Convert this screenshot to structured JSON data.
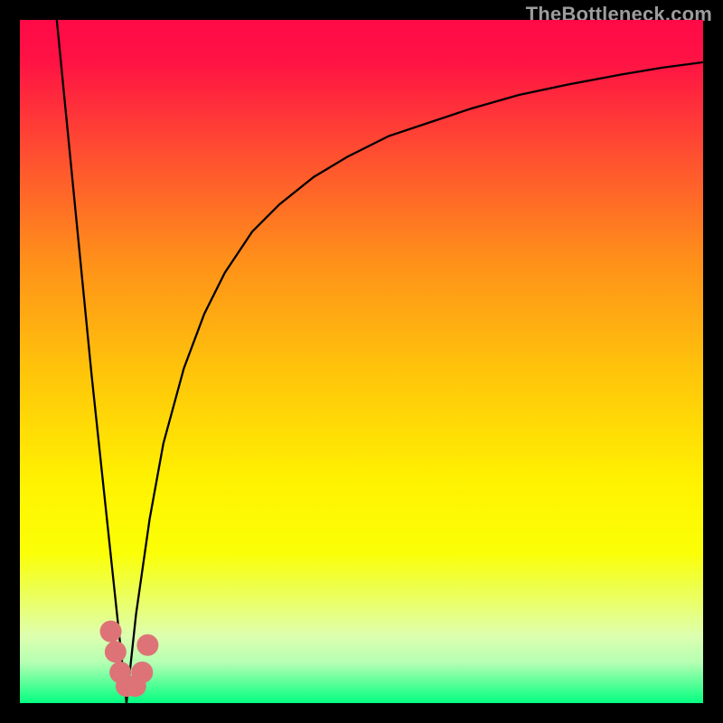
{
  "watermark": "TheBottleneck.com",
  "chart_data": {
    "type": "line",
    "title": "",
    "xlabel": "",
    "ylabel": "",
    "xlim": [
      0,
      100
    ],
    "ylim": [
      0,
      100
    ],
    "grid": false,
    "series": [
      {
        "name": "left-descending-line",
        "color": "#000000",
        "x": [
          5.4,
          10.5,
          15.6
        ],
        "values": [
          100,
          48,
          0
        ]
      },
      {
        "name": "right-rising-curve",
        "color": "#000000",
        "x": [
          15.6,
          17,
          19,
          21,
          24,
          27,
          30,
          34,
          38,
          43,
          48,
          54,
          60,
          66,
          73,
          80,
          88,
          94,
          100
        ],
        "values": [
          0,
          13,
          27,
          38,
          49,
          57,
          63,
          69,
          73,
          77,
          80,
          83,
          85,
          87,
          89,
          90.5,
          92,
          93,
          93.8
        ]
      },
      {
        "name": "valley-marker",
        "type": "scatter",
        "color": "#dd7377",
        "x": [
          13.3,
          14.0,
          14.7,
          15.6,
          16.9,
          17.9,
          18.7
        ],
        "values": [
          10.5,
          7.5,
          4.5,
          2.5,
          2.5,
          4.5,
          8.5
        ]
      }
    ],
    "background_gradient": {
      "stops": [
        {
          "offset": 0.0,
          "color": "#ff0a47"
        },
        {
          "offset": 0.06,
          "color": "#ff1244"
        },
        {
          "offset": 0.2,
          "color": "#ff5030"
        },
        {
          "offset": 0.35,
          "color": "#ff8f1a"
        },
        {
          "offset": 0.52,
          "color": "#ffc60a"
        },
        {
          "offset": 0.68,
          "color": "#fff301"
        },
        {
          "offset": 0.78,
          "color": "#fbff06"
        },
        {
          "offset": 0.82,
          "color": "#f0ff3d"
        },
        {
          "offset": 0.86,
          "color": "#e8ff74"
        },
        {
          "offset": 0.9,
          "color": "#deffae"
        },
        {
          "offset": 0.94,
          "color": "#b6ffb3"
        },
        {
          "offset": 0.97,
          "color": "#5dff9a"
        },
        {
          "offset": 1.0,
          "color": "#03ff81"
        }
      ]
    }
  }
}
